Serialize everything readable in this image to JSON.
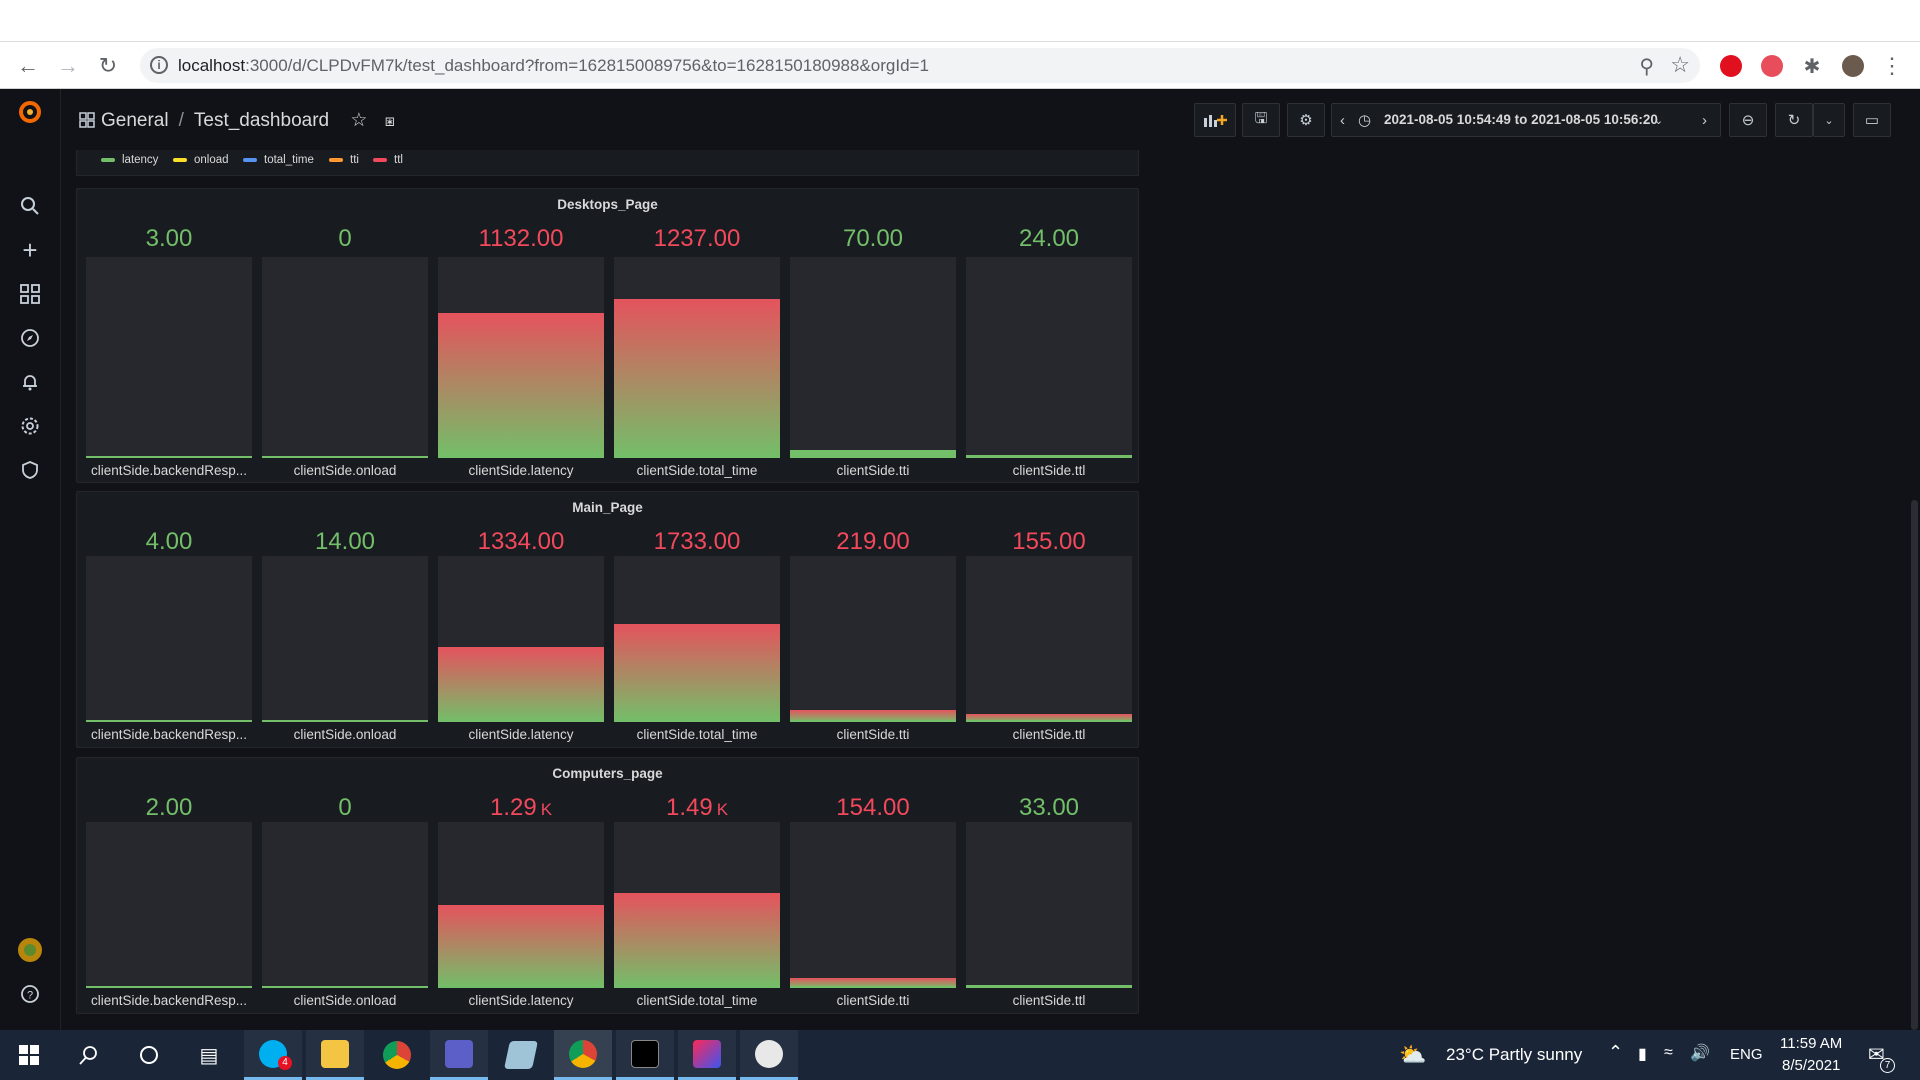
{
  "browser": {
    "url_host": "localhost",
    "url_rest": ":3000/d/CLPDvFM7k/test_dashboard?from=1628150089756&to=1628150180988&orgId=1"
  },
  "grafana": {
    "breadcrumb_folder": "General",
    "breadcrumb_sep": "/",
    "dashboard_title": "Test_dashboard",
    "time_range": "2021-08-05 10:54:49 to 2021-08-05 10:56:20",
    "legend": [
      {
        "label": "latency",
        "color": "#73bf69"
      },
      {
        "label": "onload",
        "color": "#fade2a"
      },
      {
        "label": "total_time",
        "color": "#5794f2"
      },
      {
        "label": "tti",
        "color": "#ff9830"
      },
      {
        "label": "ttl",
        "color": "#f2495c"
      }
    ],
    "colors": {
      "green": "#73bf69",
      "red": "#f2495c"
    },
    "panels": [
      {
        "title": "Desktops_Page",
        "gauges": [
          {
            "value": "3.00",
            "unit": "",
            "label": "clientSide.backendResp...",
            "color": "green",
            "fill": 0
          },
          {
            "value": "0",
            "unit": "",
            "label": "clientSide.onload",
            "color": "green",
            "fill": 0
          },
          {
            "value": "1132.00",
            "unit": "",
            "label": "clientSide.latency",
            "color": "red",
            "fill": 0.72
          },
          {
            "value": "1237.00",
            "unit": "",
            "label": "clientSide.total_time",
            "color": "red",
            "fill": 0.79
          },
          {
            "value": "70.00",
            "unit": "",
            "label": "clientSide.tti",
            "color": "green",
            "fill": 0.04
          },
          {
            "value": "24.00",
            "unit": "",
            "label": "clientSide.ttl",
            "color": "green",
            "fill": 0.01
          }
        ]
      },
      {
        "title": "Main_Page",
        "gauges": [
          {
            "value": "4.00",
            "unit": "",
            "label": "clientSide.backendResp...",
            "color": "green",
            "fill": 0
          },
          {
            "value": "14.00",
            "unit": "",
            "label": "clientSide.onload",
            "color": "green",
            "fill": 0
          },
          {
            "value": "1334.00",
            "unit": "",
            "label": "clientSide.latency",
            "color": "red",
            "fill": 0.45
          },
          {
            "value": "1733.00",
            "unit": "",
            "label": "clientSide.total_time",
            "color": "red",
            "fill": 0.59
          },
          {
            "value": "219.00",
            "unit": "",
            "label": "clientSide.tti",
            "color": "red",
            "fill": 0.07
          },
          {
            "value": "155.00",
            "unit": "",
            "label": "clientSide.ttl",
            "color": "red",
            "fill": 0.05
          }
        ]
      },
      {
        "title": "Computers_page",
        "gauges": [
          {
            "value": "2.00",
            "unit": "",
            "label": "clientSide.backendResp...",
            "color": "green",
            "fill": 0
          },
          {
            "value": "0",
            "unit": "",
            "label": "clientSide.onload",
            "color": "green",
            "fill": 0
          },
          {
            "value": "1.29",
            "unit": "K",
            "label": "clientSide.latency",
            "color": "red",
            "fill": 0.5
          },
          {
            "value": "1.49",
            "unit": "K",
            "label": "clientSide.total_time",
            "color": "red",
            "fill": 0.57
          },
          {
            "value": "154.00",
            "unit": "",
            "label": "clientSide.tti",
            "color": "red",
            "fill": 0.06
          },
          {
            "value": "33.00",
            "unit": "",
            "label": "clientSide.ttl",
            "color": "green",
            "fill": 0.01
          }
        ]
      }
    ]
  },
  "taskbar": {
    "skype_badge": "4",
    "weather": "23°C  Partly sunny",
    "language": "ENG",
    "time": "11:59 AM",
    "date": "8/5/2021",
    "notifications": "7"
  }
}
